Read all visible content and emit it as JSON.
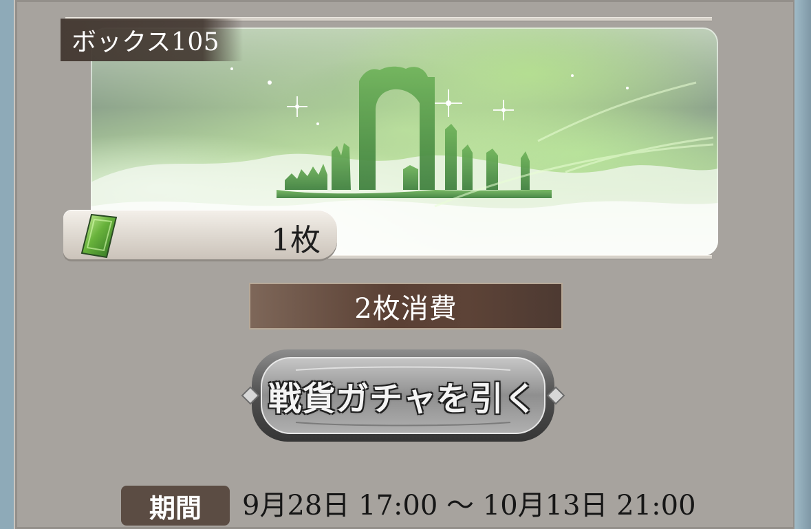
{
  "box": {
    "label": "ボックス105",
    "ticket_count": "1枚"
  },
  "cost": {
    "label": "2枚消費"
  },
  "gacha_button": {
    "label": "戦貨ガチャを引く"
  },
  "period": {
    "label": "期間",
    "range": "9月28日 17:00 〜 10月13日 21:00"
  },
  "icons": {
    "ticket": "green-ticket-icon",
    "diamond": "diamond-ornament-icon"
  },
  "colors": {
    "panel": "#a7a39e",
    "label_bg": "#5b4c43",
    "cost_bg": "#5a4034",
    "banner_green": "#9fd27d"
  }
}
